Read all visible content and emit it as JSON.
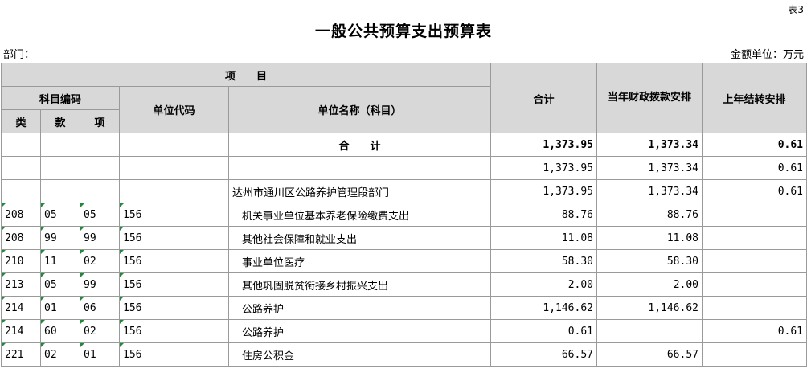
{
  "table_tag": "表3",
  "title": "一般公共预算支出预算表",
  "department_label": "部门：",
  "unit_label": "金额单位：万元",
  "header": {
    "item": "项　　目",
    "subject_code": "科目编码",
    "lei": "类",
    "kuan": "款",
    "xiang": "项",
    "unit_code": "单位代码",
    "unit_name": "单位名称（科目）",
    "total": "合计",
    "current_year": "当年财政拨款安排",
    "last_year": "上年结转安排"
  },
  "summary_rows": [
    {
      "name": "合　　计",
      "total": "1,373.95",
      "current": "1,373.34",
      "last": "0.61"
    },
    {
      "name": "",
      "total": "1,373.95",
      "current": "1,373.34",
      "last": "0.61"
    },
    {
      "name": "达州市通川区公路养护管理段部门",
      "total": "1,373.95",
      "current": "1,373.34",
      "last": "0.61"
    }
  ],
  "rows": [
    {
      "lei": "208",
      "kuan": "05",
      "xiang": "05",
      "unit_code": "156",
      "name": "机关事业单位基本养老保险缴费支出",
      "total": "88.76",
      "current": "88.76",
      "last": ""
    },
    {
      "lei": "208",
      "kuan": "99",
      "xiang": "99",
      "unit_code": "156",
      "name": "其他社会保障和就业支出",
      "total": "11.08",
      "current": "11.08",
      "last": ""
    },
    {
      "lei": "210",
      "kuan": "11",
      "xiang": "02",
      "unit_code": "156",
      "name": "事业单位医疗",
      "total": "58.30",
      "current": "58.30",
      "last": ""
    },
    {
      "lei": "213",
      "kuan": "05",
      "xiang": "99",
      "unit_code": "156",
      "name": "其他巩固脱贫衔接乡村振兴支出",
      "total": "2.00",
      "current": "2.00",
      "last": ""
    },
    {
      "lei": "214",
      "kuan": "01",
      "xiang": "06",
      "unit_code": "156",
      "name": "公路养护",
      "total": "1,146.62",
      "current": "1,146.62",
      "last": ""
    },
    {
      "lei": "214",
      "kuan": "60",
      "xiang": "02",
      "unit_code": "156",
      "name": "公路养护",
      "total": "0.61",
      "current": "",
      "last": "0.61"
    },
    {
      "lei": "221",
      "kuan": "02",
      "xiang": "01",
      "unit_code": "156",
      "name": "住房公积金",
      "total": "66.57",
      "current": "66.57",
      "last": ""
    }
  ]
}
